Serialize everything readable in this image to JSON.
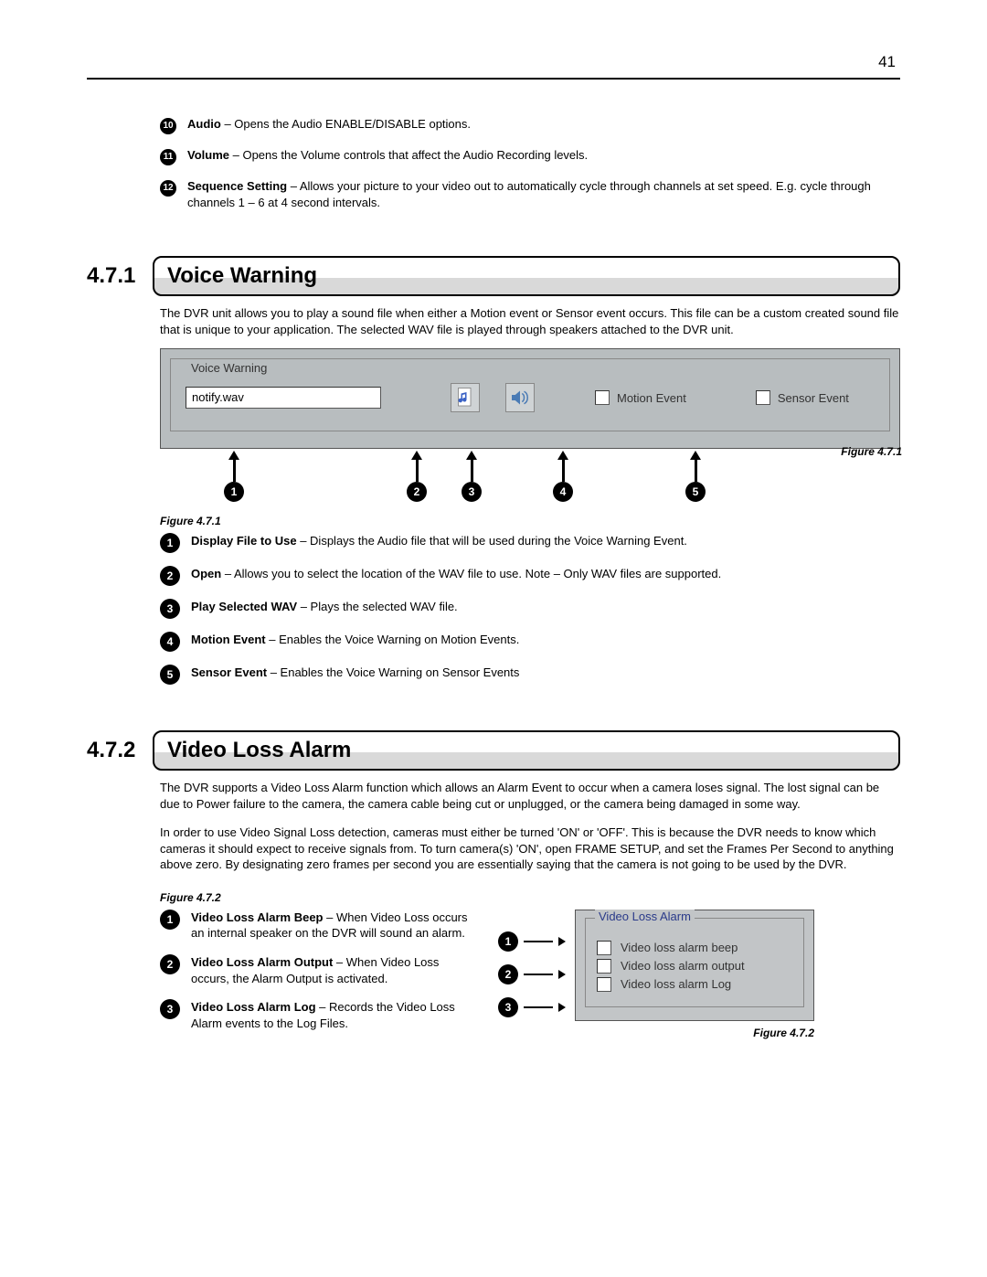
{
  "page_number": "41",
  "top_items": [
    {
      "n": "10",
      "bold": "Audio",
      "rest": " – Opens the Audio ENABLE/DISABLE options."
    },
    {
      "n": "11",
      "bold": "Volume",
      "rest": " – Opens the Volume controls that affect the Audio Recording levels."
    },
    {
      "n": "12",
      "bold": "Sequence Setting",
      "rest": " – Allows your picture to your video out to automatically cycle through channels at set speed. E.g. cycle through channels 1 – 6 at 4 second intervals."
    }
  ],
  "sec471": {
    "num": "4.7.1",
    "title": "Voice Warning",
    "para": "The DVR unit allows you to play a sound file when either a Motion event or Sensor event occurs. This file can be a custom created sound file that is unique to your application. The selected WAV file is played through speakers attached to the DVR unit.",
    "legendTitle": "Voice Warning",
    "filename": "notify.wav",
    "motion": "Motion Event",
    "sensor": "Sensor Event",
    "figcap_a": "Figure 4.7.1",
    "figcap_b": "Figure 4.7.1",
    "legend": [
      {
        "n": "1",
        "bold": "Display File to Use",
        "rest": " – Displays the Audio file that will be used during the Voice Warning Event."
      },
      {
        "n": "2",
        "bold": "Open",
        "rest": " – Allows you to select the location of the WAV file to use. Note – Only WAV files are supported."
      },
      {
        "n": "3",
        "bold": "Play Selected WAV",
        "rest": " – Plays the selected WAV file."
      },
      {
        "n": "4",
        "bold": "Motion Event",
        "rest": " – Enables the Voice Warning on Motion Events."
      },
      {
        "n": "5",
        "bold": "Sensor Event",
        "rest": " – Enables the Voice Warning on Sensor Events"
      }
    ]
  },
  "sec472": {
    "num": "4.7.2",
    "title": "Video Loss Alarm",
    "para1": "The DVR supports a Video Loss Alarm function which allows an Alarm Event to occur when a camera loses signal. The lost signal can be due to Power failure to the camera, the camera cable being cut or unplugged, or the camera being damaged in some way.",
    "para2": "In order to use Video Signal Loss detection, cameras must either be turned 'ON' or 'OFF'. This is because the DVR needs to know which cameras it should expect to receive signals from. To turn camera(s) 'ON', open FRAME SETUP, and set the Frames Per Second to anything above zero. By designating zero frames per second you are essentially saying that the camera is not going to be used by the DVR.",
    "figcap_a": "Figure 4.7.2",
    "figcap_b": "Figure 4.7.2",
    "groupTitle": "Video Loss Alarm",
    "options": [
      "Video loss alarm beep",
      "Video loss alarm output",
      "Video loss alarm Log"
    ],
    "legend": [
      {
        "n": "1",
        "bold": "Video Loss Alarm Beep",
        "rest": " – When Video Loss occurs an internal speaker on the DVR will sound an alarm."
      },
      {
        "n": "2",
        "bold": "Video Loss Alarm Output",
        "rest": " – When Video Loss occurs, the Alarm Output is activated."
      },
      {
        "n": "3",
        "bold": "Video Loss Alarm Log",
        "rest": " – Records the Video Loss Alarm events to the Log Files."
      }
    ]
  }
}
